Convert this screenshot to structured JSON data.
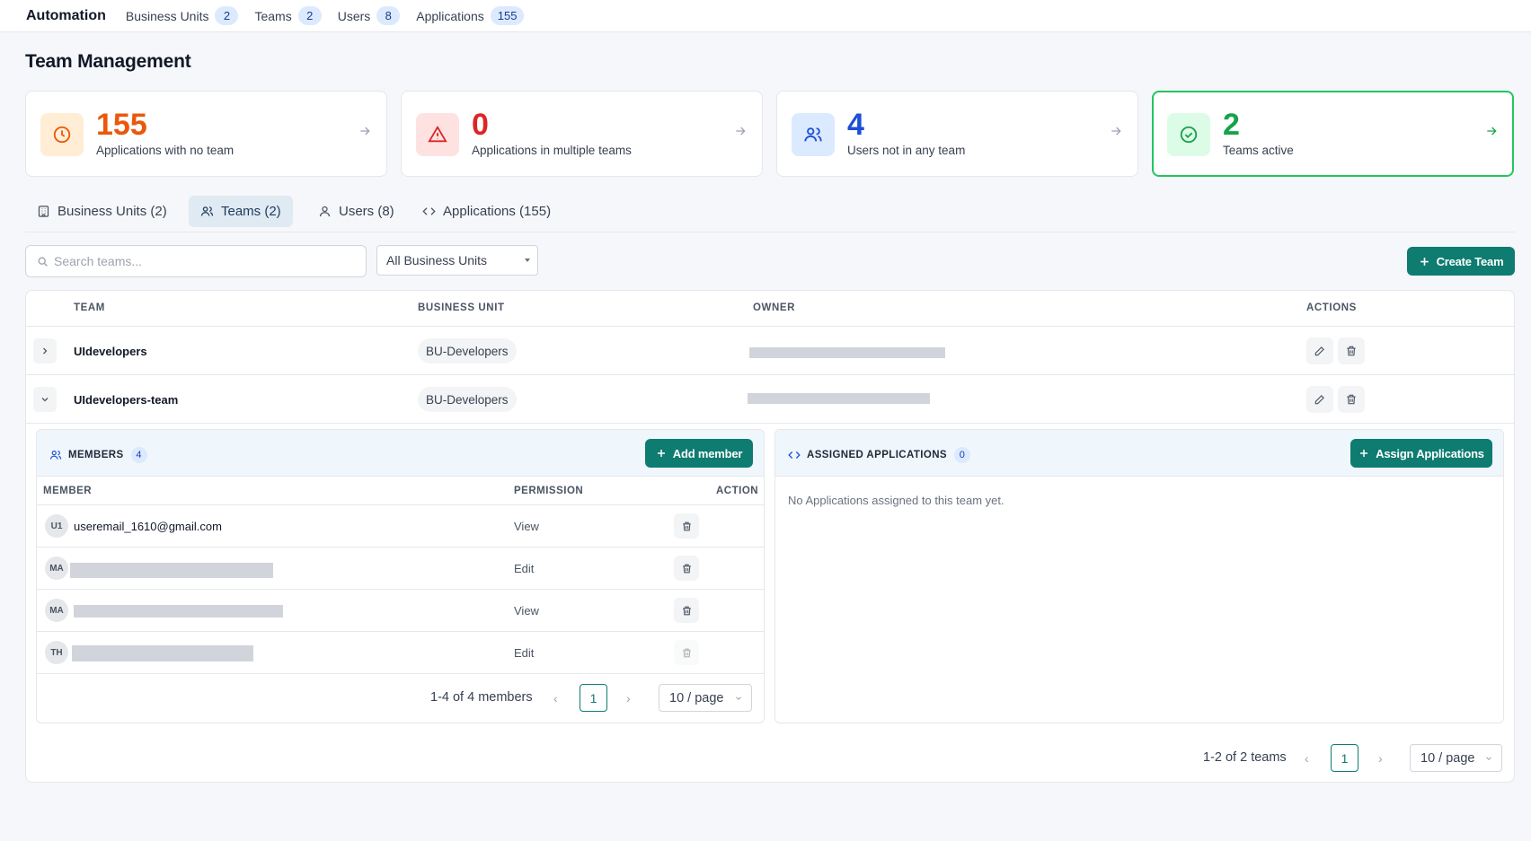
{
  "topnav": {
    "brand": "Automation",
    "items": [
      {
        "label": "Business Units",
        "count": "2"
      },
      {
        "label": "Teams",
        "count": "2"
      },
      {
        "label": "Users",
        "count": "8"
      },
      {
        "label": "Applications",
        "count": "155"
      }
    ]
  },
  "page": {
    "title": "Team Management"
  },
  "stats": [
    {
      "value": "155",
      "label": "Applications with no team",
      "color": "#ea580c",
      "icon": "clock-icon"
    },
    {
      "value": "0",
      "label": "Applications in multiple teams",
      "color": "#dc2626",
      "icon": "warning-icon"
    },
    {
      "value": "4",
      "label": "Users not in any team",
      "color": "#1d4ed8",
      "icon": "users-icon"
    },
    {
      "value": "2",
      "label": "Teams active",
      "color": "#16a34a",
      "icon": "check-circle-icon"
    }
  ],
  "tabs": [
    {
      "label": "Business Units (2)",
      "icon": "building-icon"
    },
    {
      "label": "Teams (2)",
      "icon": "users-icon"
    },
    {
      "label": "Users (8)",
      "icon": "user-icon"
    },
    {
      "label": "Applications (155)",
      "icon": "code-icon"
    }
  ],
  "toolbar": {
    "search_placeholder": "Search teams...",
    "filter_value": "All Business Units",
    "create_label": "Create Team"
  },
  "table": {
    "headers": {
      "team": "TEAM",
      "business_unit": "BUSINESS UNIT",
      "owner": "OWNER",
      "actions": "ACTIONS"
    },
    "rows": [
      {
        "team": "UIdevelopers",
        "business_unit": "BU-Developers",
        "expanded": false
      },
      {
        "team": "UIdevelopers-team",
        "business_unit": "BU-Developers",
        "expanded": true
      }
    ]
  },
  "members": {
    "title": "MEMBERS",
    "count": "4",
    "add_label": "Add member",
    "headers": {
      "member": "MEMBER",
      "permission": "PERMISSION",
      "action": "ACTION"
    },
    "rows": [
      {
        "initials": "U1",
        "email": "useremail_1610@gmail.com",
        "permission": "View"
      },
      {
        "initials": "MA",
        "email": "",
        "permission": "Edit"
      },
      {
        "initials": "MA",
        "email": "",
        "permission": "View"
      },
      {
        "initials": "TH",
        "email": "",
        "permission": "Edit"
      }
    ],
    "pagination": {
      "summary": "1-4 of 4 members",
      "page": "1",
      "page_size": "10 / page"
    }
  },
  "assigned": {
    "title": "ASSIGNED APPLICATIONS",
    "count": "0",
    "assign_label": "Assign Applications",
    "empty_text": "No Applications assigned to this team yet."
  },
  "pagination": {
    "summary": "1-2 of 2 teams",
    "page": "1",
    "page_size": "10 / page"
  },
  "colors": {
    "accent": "#0e7c70",
    "active_border": "#22c55e"
  }
}
